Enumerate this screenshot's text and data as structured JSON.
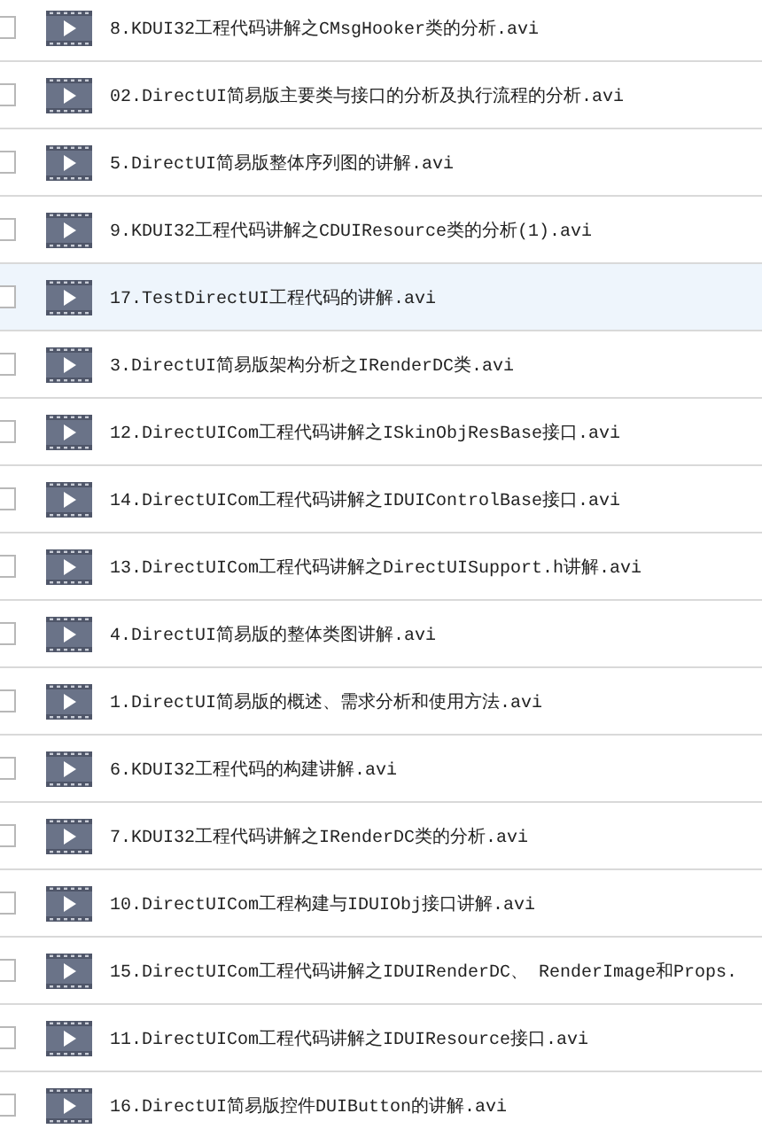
{
  "files": [
    {
      "name": "8.KDUI32工程代码讲解之CMsgHooker类的分析.avi",
      "selected": false
    },
    {
      "name": "02.DirectUI简易版主要类与接口的分析及执行流程的分析.avi",
      "selected": false
    },
    {
      "name": "5.DirectUI简易版整体序列图的讲解.avi",
      "selected": false
    },
    {
      "name": "9.KDUI32工程代码讲解之CDUIResource类的分析(1).avi",
      "selected": false
    },
    {
      "name": "17.TestDirectUI工程代码的讲解.avi",
      "selected": true
    },
    {
      "name": "3.DirectUI简易版架构分析之IRenderDC类.avi",
      "selected": false
    },
    {
      "name": "12.DirectUICom工程代码讲解之ISkinObjResBase接口.avi",
      "selected": false
    },
    {
      "name": "14.DirectUICom工程代码讲解之IDUIControlBase接口.avi",
      "selected": false
    },
    {
      "name": "13.DirectUICom工程代码讲解之DirectUISupport.h讲解.avi",
      "selected": false
    },
    {
      "name": "4.DirectUI简易版的整体类图讲解.avi",
      "selected": false
    },
    {
      "name": "1.DirectUI简易版的概述、需求分析和使用方法.avi",
      "selected": false
    },
    {
      "name": "6.KDUI32工程代码的构建讲解.avi",
      "selected": false
    },
    {
      "name": "7.KDUI32工程代码讲解之IRenderDC类的分析.avi",
      "selected": false
    },
    {
      "name": "10.DirectUICom工程构建与IDUIObj接口讲解.avi",
      "selected": false
    },
    {
      "name": "15.DirectUICom工程代码讲解之IDUIRenderDC、 RenderImage和Props.",
      "selected": false
    },
    {
      "name": "11.DirectUICom工程代码讲解之IDUIResource接口.avi",
      "selected": false
    },
    {
      "name": "16.DirectUI简易版控件DUIButton的讲解.avi",
      "selected": false
    }
  ]
}
